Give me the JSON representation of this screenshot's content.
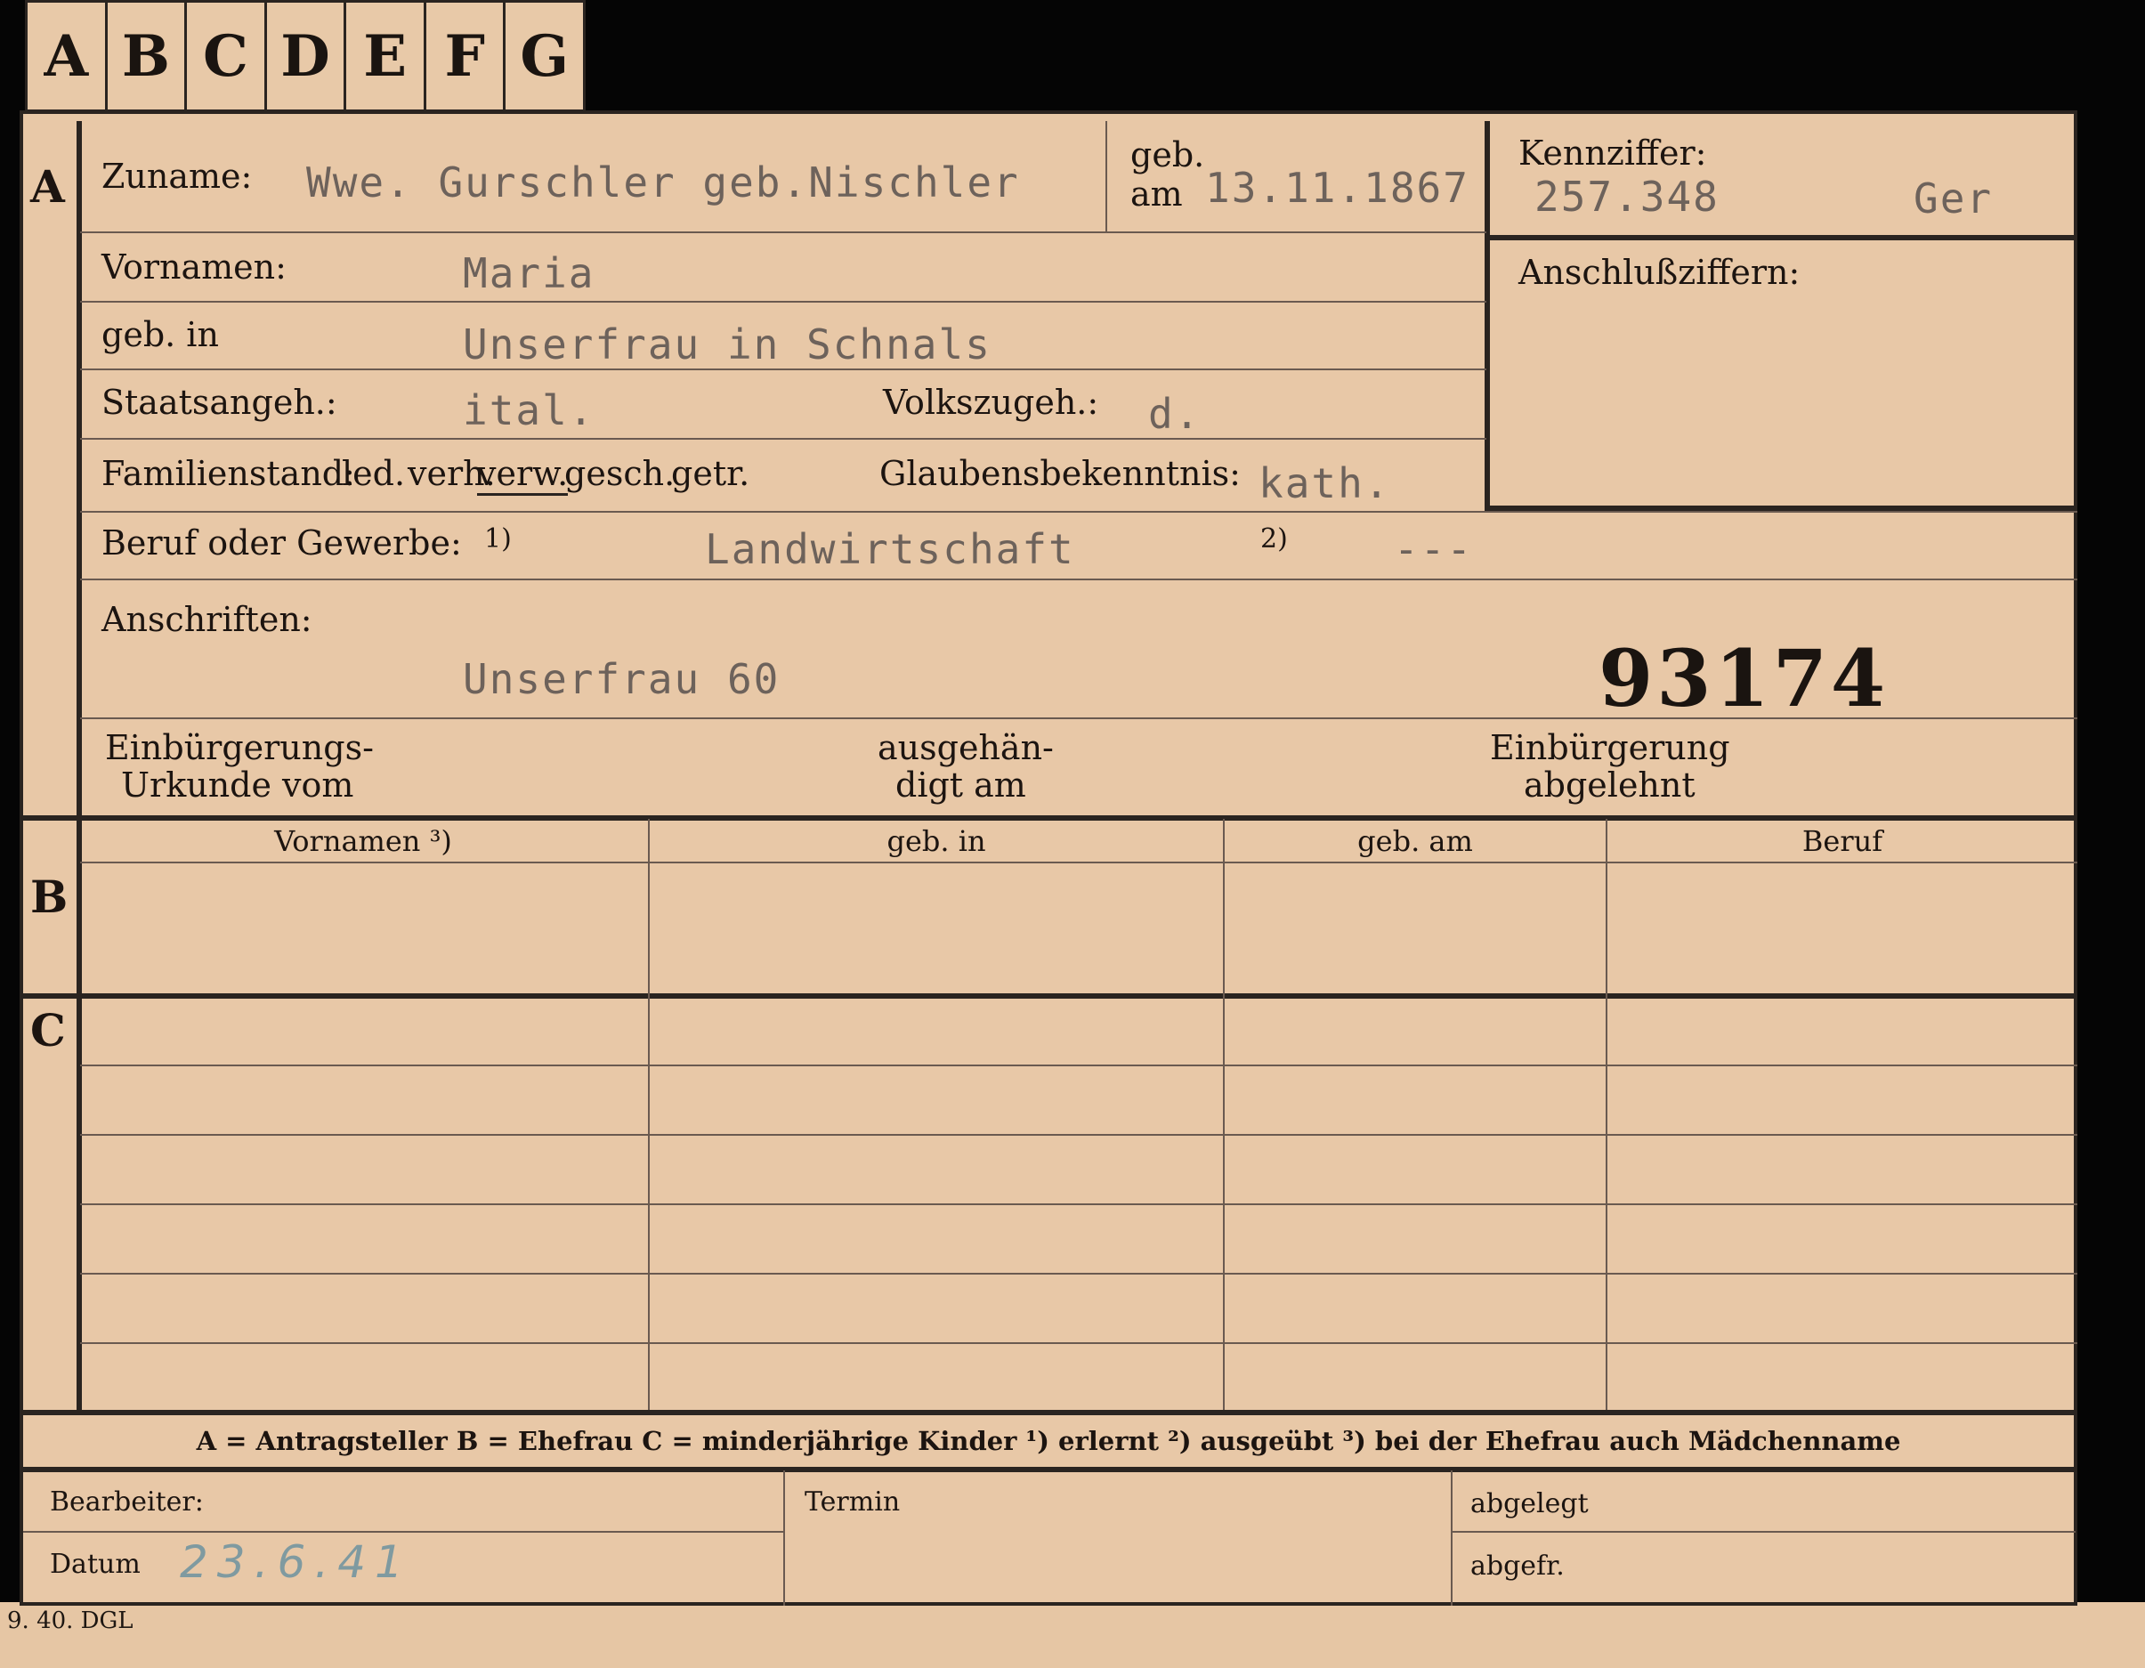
{
  "tabs": [
    "A",
    "B",
    "C",
    "D",
    "E",
    "F",
    "G"
  ],
  "sections": {
    "a": "A",
    "b": "B",
    "c": "C"
  },
  "applicant": {
    "surname_label": "Zuname:",
    "surname_value": "Wwe. Gurschler  geb.Nischler",
    "born_label_1": "geb.",
    "born_label_2": "am",
    "born_value": "13.11.1867",
    "kennziffer_label": "Kennziffer:",
    "kennziffer_value": "257.348",
    "kennziffer_suffix": "Ger",
    "anschluss_label": "Anschlußziffern:",
    "vornamen_label": "Vornamen:",
    "vornamen_value": "Maria",
    "gebin_label": "geb. in",
    "gebin_value": "Unserfrau in Schnals",
    "staats_label": "Staatsangeh.:",
    "staats_value": "ital.",
    "volks_label": "Volkszugeh.:",
    "volks_value": "d.",
    "familien_label": "Familienstand:",
    "familien_opts": [
      "led.",
      "verh.",
      "verw.",
      "gesch.",
      "getr."
    ],
    "glauben_label": "Glaubensbekenntnis:",
    "glauben_value": "kath.",
    "beruf_label": "Beruf oder Gewerbe:",
    "beruf_fn1": "1)",
    "beruf_value": "Landwirtschaft",
    "beruf_fn2": "2)",
    "beruf_value2": "---",
    "anschriften_label": "Anschriften:",
    "anschriften_value": "Unserfrau  60",
    "record_number": "93174",
    "einb_urkunde_1": "Einbürgerungs-",
    "einb_urkunde_2": "Urkunde vom",
    "ausgehaendigt_1": "ausgehän-",
    "ausgehaendigt_2": "digt am",
    "einb_abgelehnt_1": "Einbürgerung",
    "einb_abgelehnt_2": "abgelehnt"
  },
  "spouse_table": {
    "headers": [
      "Vornamen ³)",
      "geb. in",
      "geb. am",
      "Beruf"
    ]
  },
  "legend": "A = Antragsteller    B = Ehefrau    C = minderjährige Kinder    ¹) erlernt    ²) ausgeübt    ³) bei der Ehefrau auch Mädchenname",
  "bottom": {
    "bearbeiter_label": "Bearbeiter:",
    "datum_label": "Datum",
    "datum_value": "23.6.41",
    "termin_label": "Termin",
    "abgelegt_label": "abgelegt",
    "abgefr_label": "abgefr."
  },
  "print_note": "9. 40. DGL"
}
